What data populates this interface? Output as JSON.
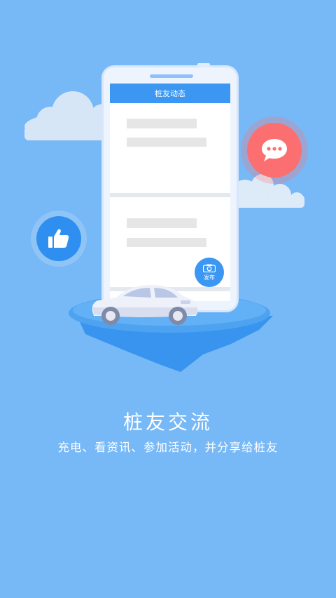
{
  "colors": {
    "background": "#77b8f6",
    "accent": "#3b97f2",
    "chat_bubble": "#fb6f70",
    "thumb_badge": "#2f8ff0"
  },
  "phone_screen": {
    "header_title": "桩友动态",
    "publish_button_label": "发布",
    "publish_icon": "camera-icon"
  },
  "icons": {
    "thumbs_up": "thumbs-up-icon",
    "chat": "chat-bubble-icon",
    "car": "car-illustration"
  },
  "caption": {
    "title": "桩友交流",
    "subtitle": "充电、看资讯、参加活动，并分享给桩友"
  }
}
